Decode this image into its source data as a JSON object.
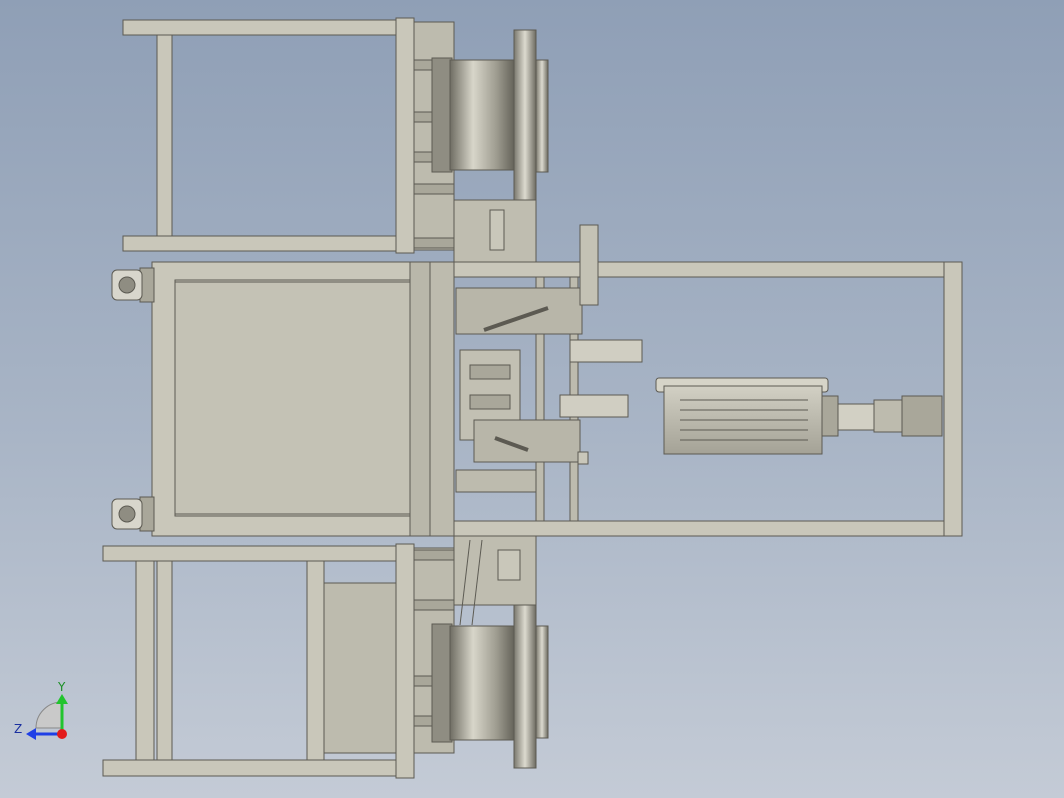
{
  "view": {
    "background_top": "#8f9fb6",
    "background_bottom": "#c4cbd6",
    "part_color": "#c9c7ba",
    "part_shade": "#a9a79a",
    "edge_color": "#5c5a52"
  },
  "triad": {
    "y_label": "Y",
    "z_label": "Z",
    "y_color": "#22c42e",
    "z_color": "#1f3fe6",
    "x_color": "#e31b1b"
  }
}
